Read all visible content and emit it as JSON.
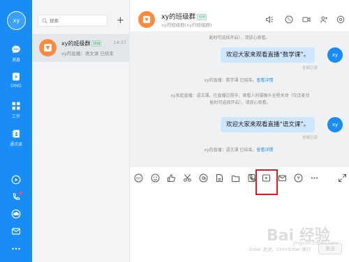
{
  "nav": {
    "avatar": "xy",
    "items": [
      {
        "label": "消息",
        "icon": "chat-bubble-icon"
      },
      {
        "label": "DING",
        "icon": "ding-icon"
      },
      {
        "label": "工作",
        "icon": "grid-icon"
      },
      {
        "label": "通讯录",
        "icon": "contacts-icon"
      }
    ],
    "bottom_icons": [
      "play-circle-icon",
      "phone-icon",
      "cloud-icon",
      "mail-icon",
      "more-icon"
    ],
    "accent": "#1a8cf5"
  },
  "list": {
    "search_placeholder": "搜索",
    "add_label": "+",
    "conversation": {
      "name": "xy的班级群",
      "tag": "班级",
      "time": "14:37",
      "preview": "xy的直播：语文课 已结束"
    }
  },
  "chat": {
    "title": "xy的班级群",
    "tag": "班级",
    "subtitle": "xy的班级群(xy的班级群)",
    "header_icons": [
      "speaker-icon",
      "phone-icon",
      "video-icon",
      "add-member-icon",
      "settings-icon"
    ],
    "messages": {
      "sys_top": "能时可选择开启），请放心观看。",
      "bubble1": "欢迎大家来观看直播“数学课”。",
      "read1": "全部已读",
      "live_end1_text": "xy的直播：数学课 已结束。",
      "live_end1_link": "查看详情",
      "live_start_line1": "xy发起直播：语文课。在直播过程中，观看人的摄像头全程关闭（仅连麦功",
      "live_start_line2": "能时可选择开启），请放心观看。",
      "bubble2": "欢迎大家来观看直播“语文课”。",
      "read2": "全部已读",
      "live_end2_text": "xy的直播：语文课 已结束。",
      "live_end2_link": "查看详情",
      "me_avatar": "xy"
    },
    "toolbar_icons": [
      "gif-icon",
      "emoji-icon",
      "thumbs-up-icon",
      "scissors-icon",
      "at-icon",
      "file-icon",
      "folder-icon",
      "ding-icon",
      "phone-icon",
      "live-play-icon",
      "mail-icon",
      "red-packet-icon",
      "more-icon",
      "expand-icon"
    ],
    "hint": "Enter 发送，Ctrl+Enter 换行",
    "send_label": "发送"
  },
  "watermark": {
    "main": "Bai 经验",
    "sub": "jingyan.baidu.com"
  }
}
